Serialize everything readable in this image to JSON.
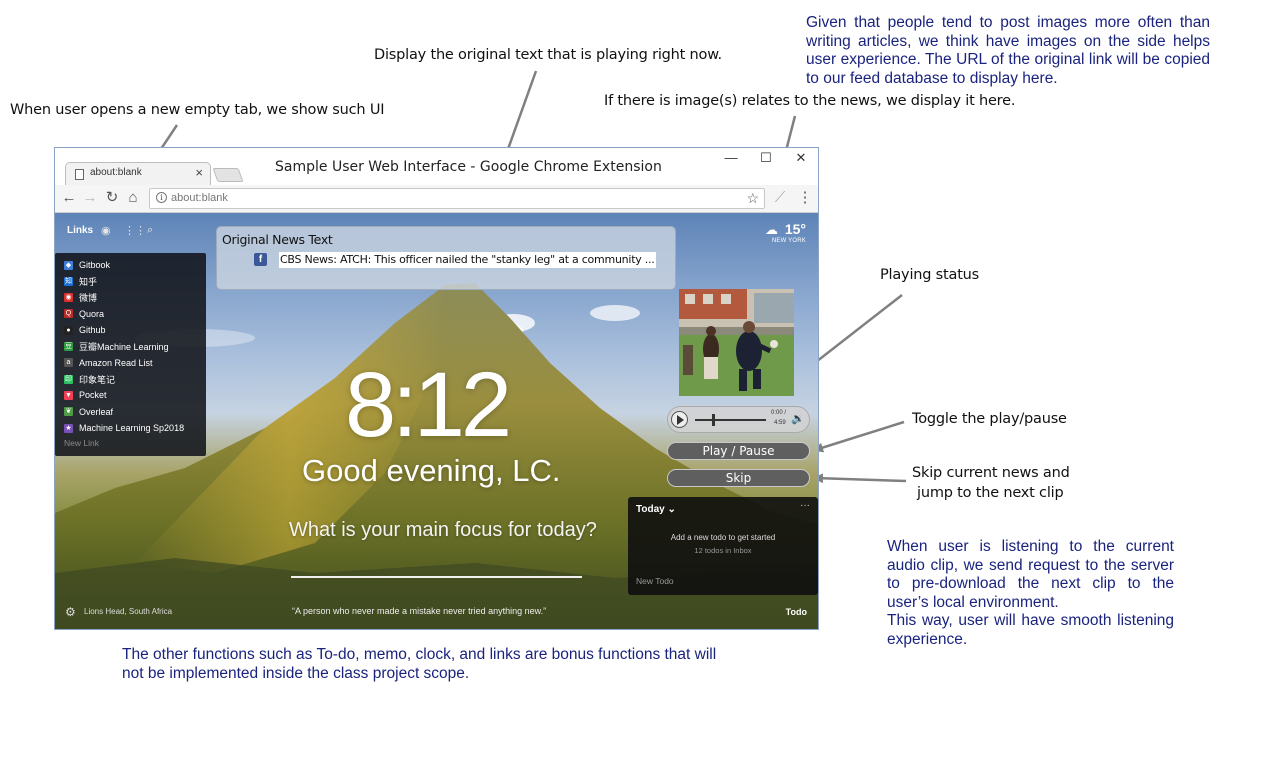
{
  "annotations": {
    "new_tab_note": "When user opens a new empty tab, we show such UI",
    "original_text_note": "Display the original text that is playing right now.",
    "image_note": "If there is image(s) relates to the news, we display it here.",
    "images_rationale": "Given that people tend to post images more often than writing articles, we think have images on the side helps user experience. The URL of the original link will be copied to our feed database to display here.",
    "playing_status_note": "Playing status",
    "toggle_note": "Toggle the play/pause",
    "skip_note_line1": "Skip current news and",
    "skip_note_line2": "jump to the next clip",
    "predownload_note_1": "When user is listening to the current audio clip, we send request to the server to pre-download the next clip to the user’s local environment.",
    "predownload_note_2": "This way, user will have smooth listening experience.",
    "bonus_note": "The other functions such as To-do, memo, clock, and links are bonus functions that will not be implemented inside the class project scope."
  },
  "browser": {
    "window_title": "Sample User Web Interface - Google Chrome Extension",
    "tab_title": "about:blank",
    "tab_close": "×",
    "url": "about:blank",
    "minimize": "—",
    "maximize": "☐",
    "close": "✕"
  },
  "newtab": {
    "links_label": "Links",
    "links": [
      {
        "label": "Gitbook",
        "color": "#3d7ed9",
        "glyph": "◆"
      },
      {
        "label": "知乎",
        "color": "#1b6fd1",
        "glyph": "知"
      },
      {
        "label": "微博",
        "color": "#d9302c",
        "glyph": "◉"
      },
      {
        "label": "Quora",
        "color": "#b92b27",
        "glyph": "Q"
      },
      {
        "label": "Github",
        "color": "#222222",
        "glyph": "●"
      },
      {
        "label": "豆瓣Machine Learning",
        "color": "#2e9a3e",
        "glyph": "豆"
      },
      {
        "label": "Amazon Read List",
        "color": "#555555",
        "glyph": "a"
      },
      {
        "label": "印象笔记",
        "color": "#2dbe60",
        "glyph": "印"
      },
      {
        "label": "Pocket",
        "color": "#ef4056",
        "glyph": "▼"
      },
      {
        "label": "Overleaf",
        "color": "#4f9c45",
        "glyph": "❦"
      },
      {
        "label": "Machine Learning Sp2018",
        "color": "#7a4fb8",
        "glyph": "★"
      }
    ],
    "new_link": "New Link",
    "temperature": "15°",
    "location": "NEW YORK",
    "clock": "8:12",
    "greeting": "Good evening, LC.",
    "focus_question": "What is your main focus for today?",
    "photo_location": "Lions Head, South Africa",
    "quote": "“A person who never made a mistake never tried anything new.”",
    "todo_label": "Todo"
  },
  "news": {
    "label": "Original News Text",
    "text": "CBS News: ATCH: This officer nailed the \"stanky leg\" at a community ...",
    "source_icon": "f"
  },
  "player": {
    "elapsed": "0:00",
    "separator": "/",
    "duration": "4:59",
    "progress": 0.25
  },
  "controls": {
    "play_pause": "Play / Pause",
    "skip": "Skip"
  },
  "todo": {
    "today": "Today ⌄",
    "menu": "···",
    "add_hint": "Add a new todo to get started",
    "inbox_count": "12 todos in Inbox",
    "new_todo": "New Todo"
  }
}
